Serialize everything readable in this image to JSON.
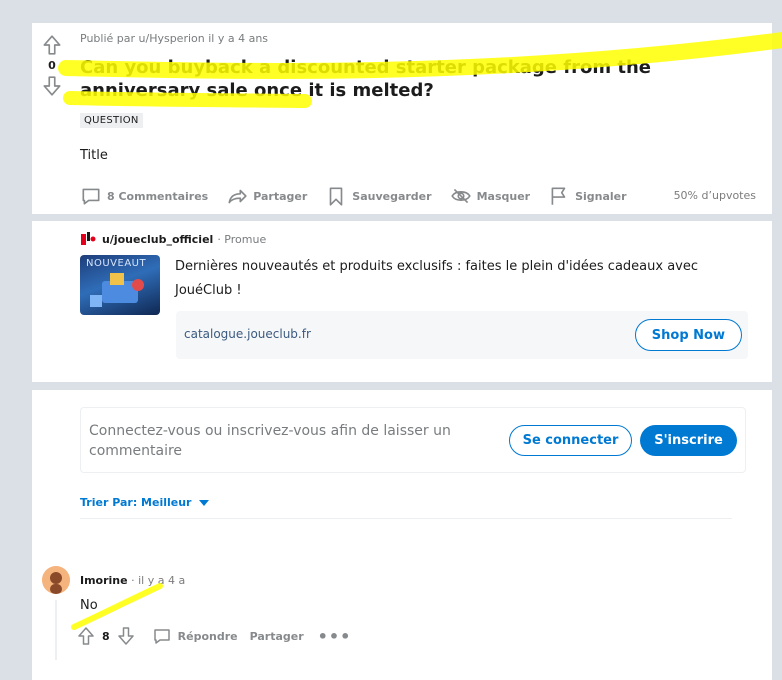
{
  "post": {
    "meta": "Publié par u/Hysperion il y a 4 ans",
    "score": "0",
    "title": "Can you buyback a discounted starter package from the anniversary sale once it is melted?",
    "flair": "QUESTION",
    "body": "Title",
    "actions": {
      "comments": "8 Commentaires",
      "share": "Partager",
      "save": "Sauvegarder",
      "hide": "Masquer",
      "report": "Signaler"
    },
    "upvote_ratio": "50% d’upvotes"
  },
  "promo": {
    "user": "u/joueclub_officiel",
    "tag": "· Promue",
    "thumb_text": "NOUVEAUT",
    "text": "Dernières nouveautés et produits exclusifs : faites le plein d'idées cadeaux avec JouéClub !",
    "link": "catalogue.joueclub.fr",
    "cta": "Shop Now"
  },
  "comments": {
    "login_prompt": "Connectez-vous ou inscrivez-vous afin de laisser un commentaire",
    "login_label": "Se connecter",
    "signup_label": "S'inscrire",
    "sort_label": "Trier Par: Meilleur",
    "items": [
      {
        "user": "Imorine",
        "time": "· il y a 4 a",
        "body": "No",
        "score": "8",
        "reply_label": "Répondre",
        "share_label": "Partager"
      }
    ]
  },
  "colors": {
    "accent": "#0079d3",
    "highlight": "#ffff00",
    "page_bg": "#dae0e6"
  }
}
